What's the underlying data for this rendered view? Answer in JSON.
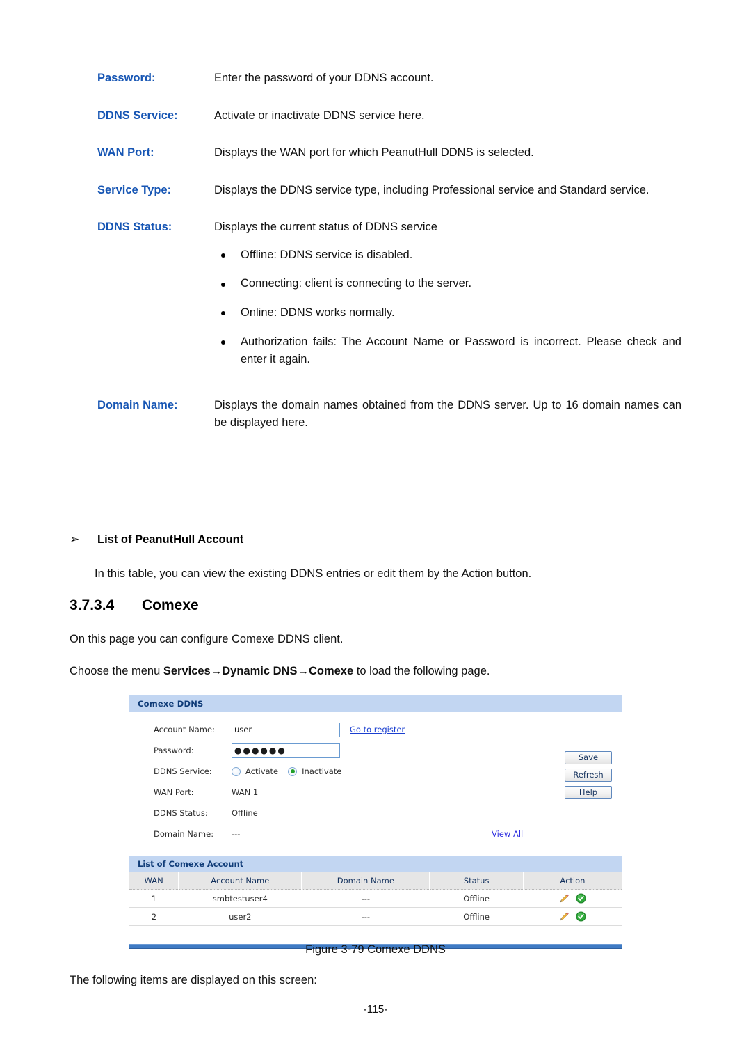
{
  "document": {
    "definitions": [
      {
        "term": "Password:",
        "desc": "Enter the password of your DDNS account."
      },
      {
        "term": "DDNS Service:",
        "desc": "Activate or inactivate DDNS service here."
      },
      {
        "term": "WAN Port:",
        "desc": "Displays the WAN port for which PeanutHull DDNS is selected."
      },
      {
        "term": "Service Type:",
        "desc": "Displays the DDNS service type, including Professional service and Standard service."
      },
      {
        "term": "DDNS Status:",
        "desc": "Displays the current status of DDNS service"
      },
      {
        "term": "Domain Name:",
        "desc": "Displays the domain names obtained from the DDNS server. Up to 16 domain names can be displayed here."
      }
    ],
    "status_bullets": [
      "Offline: DDNS service is disabled.",
      "Connecting: client is connecting to the server.",
      "Online: DDNS works normally.",
      "Authorization fails: The Account Name or Password is incorrect. Please check and enter it again."
    ],
    "arrow_heading": {
      "glyph": "➢",
      "text": "List of PeanutHull Account"
    },
    "paragraph_in_table": "In this table, you can view the existing DDNS entries or edit them by the Action button.",
    "section": {
      "number": "3.7.3.4",
      "title": "Comexe"
    },
    "paragraph_on_page": "On this page you can configure Comexe DDNS client.",
    "choose_menu": {
      "prefix": "Choose the menu ",
      "item1": "Services",
      "arrow1": "→",
      "item2": "Dynamic DNS",
      "arrow2": "→",
      "item3": "Comexe",
      "suffix": " to load the following page."
    },
    "figure_caption": "Figure 3-79 Comexe DDNS",
    "paragraph_following": "The following items are displayed on this screen:",
    "page_number": "-115-"
  },
  "screenshot": {
    "panel_title": "Comexe DDNS",
    "fields": {
      "account_name": {
        "label": "Account Name:",
        "value": "user",
        "link": "Go to register"
      },
      "password": {
        "label": "Password:",
        "value": "●●●●●●"
      },
      "ddns_service": {
        "label": "DDNS Service:",
        "options": [
          {
            "label": "Activate",
            "selected": false
          },
          {
            "label": "Inactivate",
            "selected": true
          }
        ]
      },
      "wan_port": {
        "label": "WAN Port:",
        "value": "WAN 1"
      },
      "ddns_status": {
        "label": "DDNS Status:",
        "value": "Offline"
      },
      "domain_name": {
        "label": "Domain Name:",
        "value": "---",
        "link": "View All"
      }
    },
    "buttons": {
      "save": "Save",
      "refresh": "Refresh",
      "help": "Help"
    },
    "table": {
      "title": "List of Comexe Account",
      "headers": [
        "WAN",
        "Account Name",
        "Domain Name",
        "Status",
        "Action"
      ],
      "rows": [
        {
          "wan": "1",
          "account_name": "smbtestuser4",
          "domain_name": "---",
          "status": "Offline"
        },
        {
          "wan": "2",
          "account_name": "user2",
          "domain_name": "---",
          "status": "Offline"
        }
      ]
    },
    "colors": {
      "panel_header_bg": "#c2d6f2",
      "panel_header_text": "#103c78",
      "link": "#1a3fd0",
      "radio_selected": "#22a02a",
      "rule": "#3f7bc4",
      "table_header_bg": "#e6e6e6"
    }
  }
}
